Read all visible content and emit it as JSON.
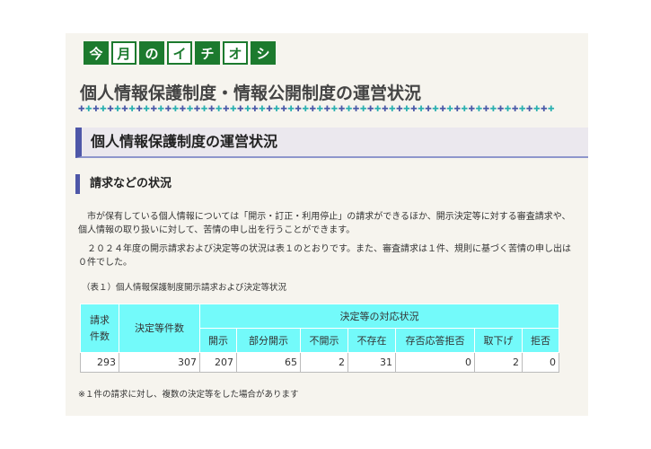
{
  "banner": {
    "chars": [
      "今",
      "月",
      "の",
      "イ",
      "チ",
      "オ",
      "シ"
    ]
  },
  "page_title": "個人情報保護制度・情報公開制度の運営状況",
  "section_heading": "個人情報保護制度の運営状況",
  "subsection_heading": "請求などの状況",
  "paragraph_1": "　市が保有している個人情報については「開示・訂正・利用停止」の請求ができるほか、開示決定等に対する審査請求や、個人情報の取り扱いに対して、苦情の申し出を行うことができます。",
  "paragraph_2": "　２０２４年度の開示請求および決定等の状況は表１のとおりです。また、審査請求は１件、規則に基づく苦情の申し出は０件でした。",
  "table_caption": "（表１）個人情報保護制度開示請求および決定等状況",
  "table": {
    "col_requests": "請求件数",
    "col_decisions": "決定等件数",
    "group_header": "決定等の対応状況",
    "sub_headers": [
      "開示",
      "部分開示",
      "不開示",
      "不存在",
      "存否応答拒否",
      "取下げ",
      "拒否"
    ],
    "row": {
      "requests": "293",
      "decisions": "307",
      "values": [
        "207",
        "65",
        "2",
        "31",
        "0",
        "2",
        "0"
      ]
    }
  },
  "footnote": "※１件の請求に対し、複数の決定等をした場合があります",
  "colors": {
    "banner_green": "#1c7a2e",
    "header_cyan": "#73fafa",
    "accent_blue": "#4e57a8",
    "panel_bg": "#f6f4ee"
  }
}
